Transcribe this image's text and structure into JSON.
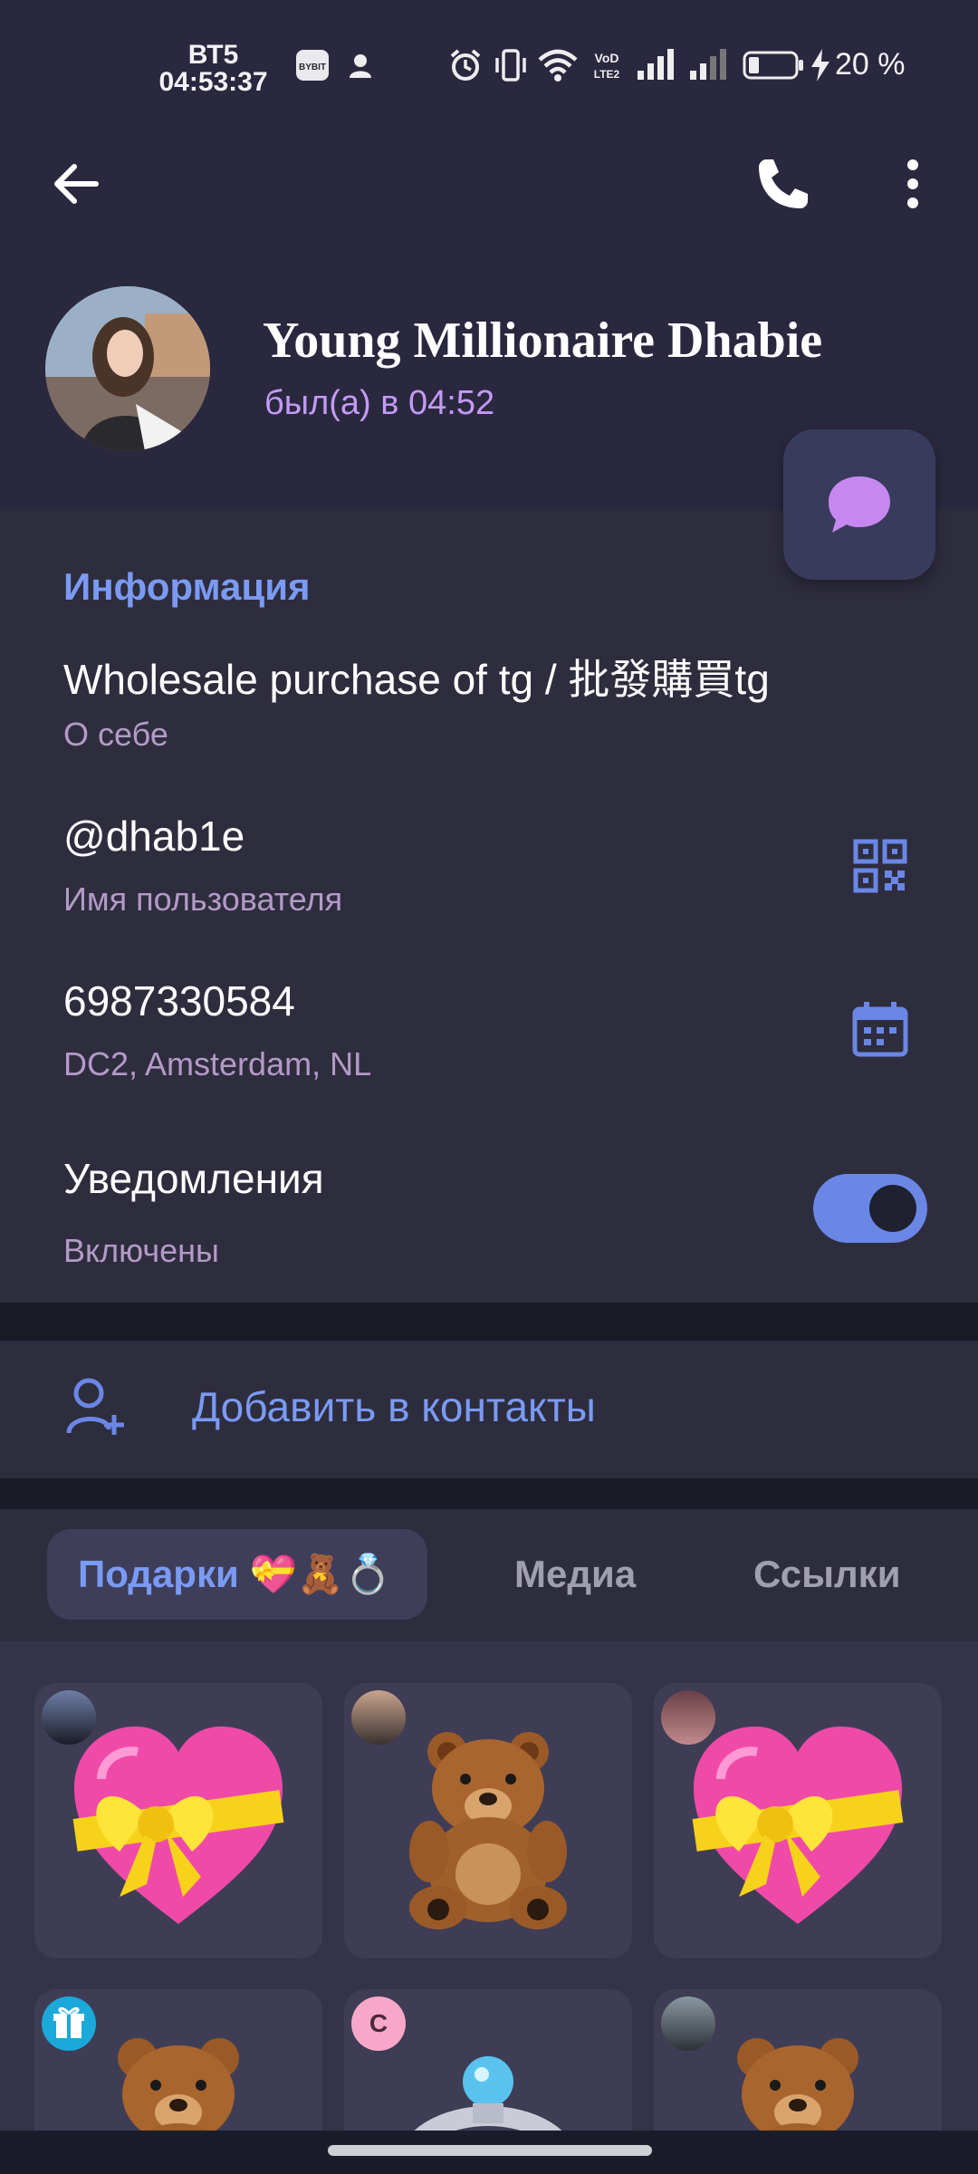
{
  "status_bar": {
    "day": "ВТ5",
    "time": "04:53:37",
    "battery": "20 %",
    "icons": [
      "bybit-app-icon",
      "person-icon",
      "alarm-icon",
      "vibrate-icon",
      "wifi-icon",
      "volte-icon",
      "signal-icon",
      "signal-icon-2",
      "battery-icon",
      "charging-icon"
    ]
  },
  "profile": {
    "name": "Young Millionaire Dhabie",
    "last_seen": "был(а) в 04:52"
  },
  "info": {
    "section_title": "Информация",
    "bio": "Wholesale purchase of tg / 批發購買tg",
    "bio_label": "О себе",
    "username": "@dhab1e",
    "username_label": "Имя пользователя",
    "user_id": "6987330584",
    "dc_location": "DC2, Amsterdam, NL",
    "notifications": "Уведомления",
    "notifications_state": "Включены",
    "notifications_on": true
  },
  "add_contact": {
    "label": "Добавить в контакты"
  },
  "tabs": {
    "gifts": "Подарки 💝🧸💍",
    "media": "Медиа",
    "links": "Ссылки",
    "active": "gifts"
  },
  "gifts": [
    {
      "item": "heart-with-ribbon",
      "sender_badge": ""
    },
    {
      "item": "teddy-bear",
      "sender_badge": ""
    },
    {
      "item": "heart-with-ribbon",
      "sender_badge": ""
    },
    {
      "item": "teddy-bear",
      "sender_badge": "gift-icon"
    },
    {
      "item": "ring",
      "sender_badge": "C"
    },
    {
      "item": "teddy-bear",
      "sender_badge": ""
    }
  ],
  "colors": {
    "header_bg": "#29283f",
    "panel_bg": "#2e2d3e",
    "accent": "#7a9af4",
    "status_accent": "#c49af4",
    "toggle_on": "#6a87e6"
  }
}
